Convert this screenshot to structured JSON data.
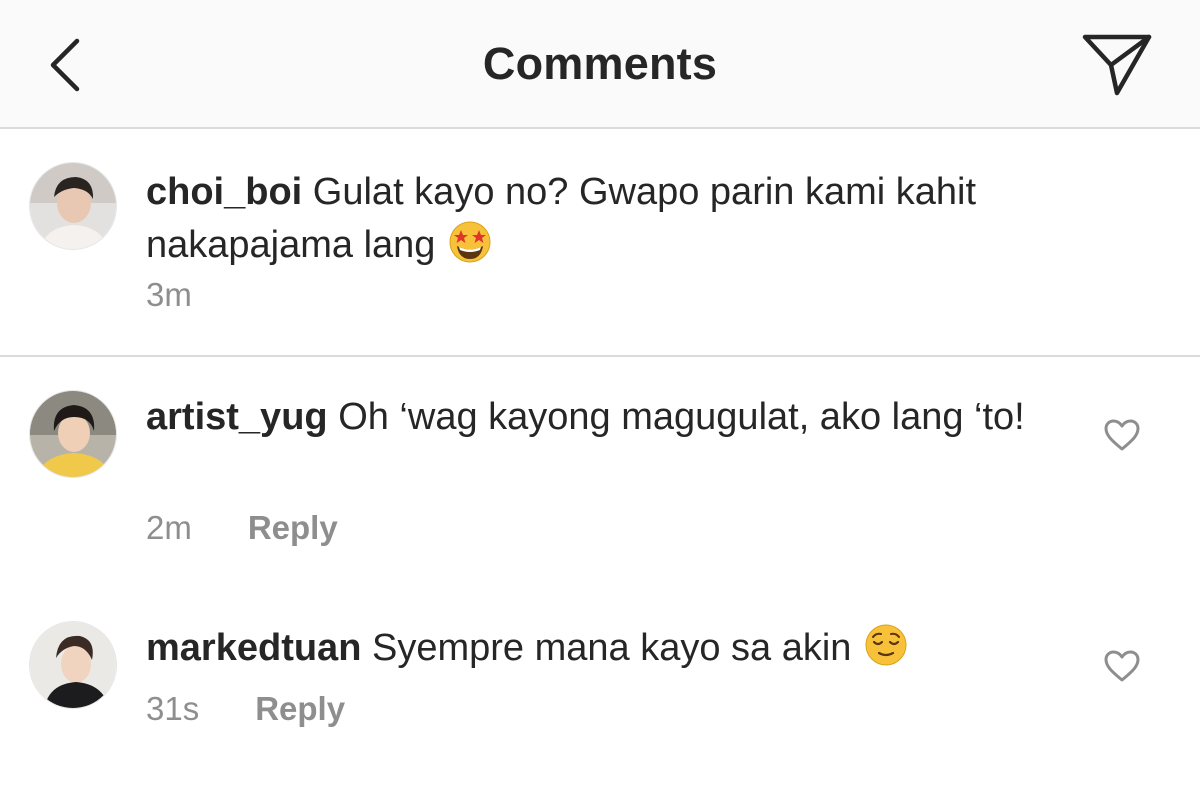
{
  "header": {
    "title": "Comments",
    "back_icon": "chevron-left-icon",
    "send_icon": "paper-plane-icon"
  },
  "caption": {
    "username": "choi_boi",
    "text": "Gulat kayo no? Gwapo parin kami kahit nakapajama lang",
    "emoji": "star-struck-emoji",
    "time": "3m"
  },
  "comments": [
    {
      "username": "artist_yug",
      "text": "Oh ‘wag kayong magugulat, ako lang ‘to!",
      "time": "2m",
      "reply_label": "Reply",
      "like_icon": "heart-outline-icon"
    },
    {
      "username": "markedtuan",
      "text": "Syempre mana kayo sa akin",
      "emoji": "relieved-face-emoji",
      "time": "31s",
      "reply_label": "Reply",
      "like_icon": "heart-outline-icon"
    }
  ],
  "colors": {
    "text": "#262626",
    "secondary": "#8e8e8e",
    "divider": "#dbdbdb",
    "header_bg": "#fafafa"
  }
}
